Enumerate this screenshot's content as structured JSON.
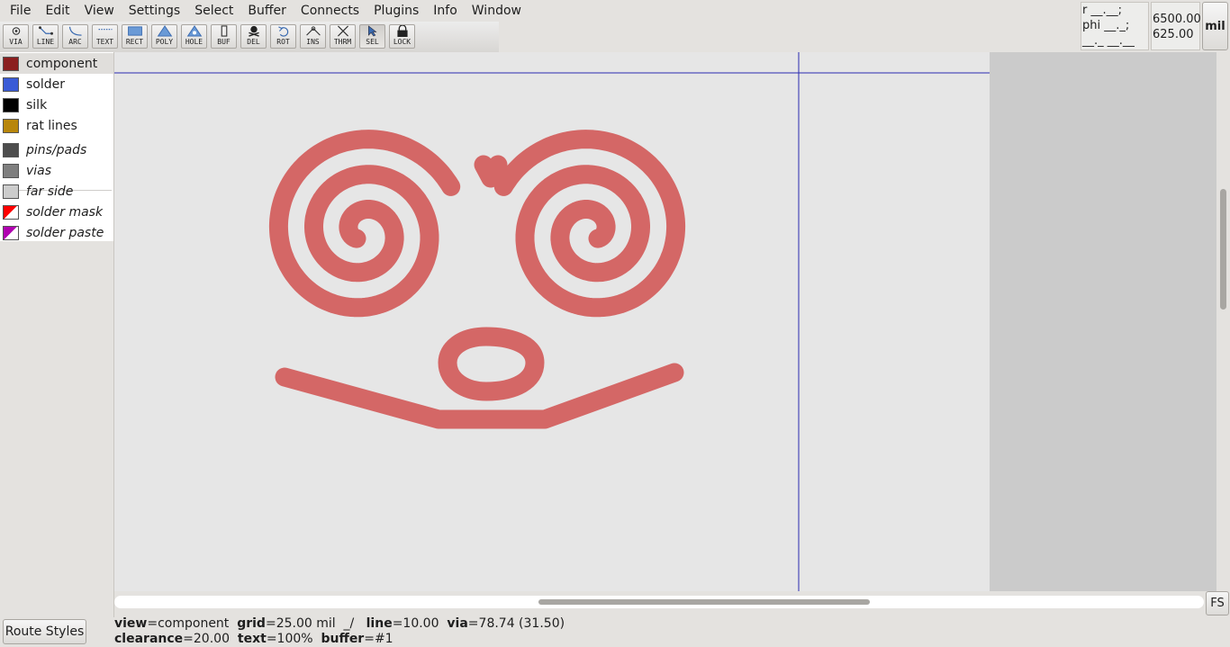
{
  "menu": [
    "File",
    "Edit",
    "View",
    "Settings",
    "Select",
    "Buffer",
    "Connects",
    "Plugins",
    "Info",
    "Window"
  ],
  "tools": [
    {
      "label": "VIA",
      "icon": "via-icon"
    },
    {
      "label": "LINE",
      "icon": "line-tool-icon"
    },
    {
      "label": "ARC",
      "icon": "arc-tool-icon"
    },
    {
      "label": "TEXT",
      "icon": "text-tool-icon"
    },
    {
      "label": "RECT",
      "icon": "rectangle-tool-icon"
    },
    {
      "label": "POLY",
      "icon": "polygon-tool-icon"
    },
    {
      "label": "HOLE",
      "icon": "hole-tool-icon"
    },
    {
      "label": "BUF",
      "icon": "buffer-tool-icon"
    },
    {
      "label": "DEL",
      "icon": "delete-tool-icon"
    },
    {
      "label": "ROT",
      "icon": "rotate-tool-icon"
    },
    {
      "label": "INS",
      "icon": "insert-point-icon"
    },
    {
      "label": "THRM",
      "icon": "thermal-tool-icon"
    },
    {
      "label": "SEL",
      "icon": "select-arrow-icon",
      "active": true
    },
    {
      "label": "LOCK",
      "icon": "lock-icon"
    }
  ],
  "coords": {
    "polar_r": "r __.__;",
    "polar_phi": "phi __._;",
    "polar_extra": "__._ __.__",
    "x": "6500.00",
    "y": "625.00",
    "units": "mil"
  },
  "layers": [
    {
      "name": "component",
      "color": "#8b1f1f",
      "italic": false,
      "selected": true
    },
    {
      "name": "solder",
      "color": "#3a5bd6",
      "italic": false
    },
    {
      "name": "silk",
      "color": "#000000",
      "italic": false
    },
    {
      "name": "rat lines",
      "color": "#b8860b",
      "italic": false
    },
    {
      "name": "pins/pads",
      "color": "#4d4d4d",
      "italic": true
    },
    {
      "name": "vias",
      "color": "#7f7f7f",
      "italic": true
    },
    {
      "name": "far side",
      "color": "#cccccc",
      "italic": true
    },
    {
      "name": "solder mask",
      "color": "#ff0000",
      "italic": true
    },
    {
      "name": "solder paste",
      "color": "#b000b0",
      "italic": true
    }
  ],
  "trace_color": "#d46766",
  "crosshair_color": "#2b2bb0",
  "buttons": {
    "route_styles": "Route Styles",
    "fullscreen": "FS"
  },
  "status": {
    "view_key": "view",
    "view_val": "component",
    "grid_key": "grid",
    "grid_val": "25.00 mil",
    "mode": "_/",
    "line_key": "line",
    "line_val": "10.00",
    "via_key": "via",
    "via_val": "78.74 (31.50)",
    "clear_key": "clearance",
    "clear_val": "20.00",
    "text_key": "text",
    "text_val": "100%",
    "buffer_key": "buffer",
    "buffer_val": "#1"
  }
}
